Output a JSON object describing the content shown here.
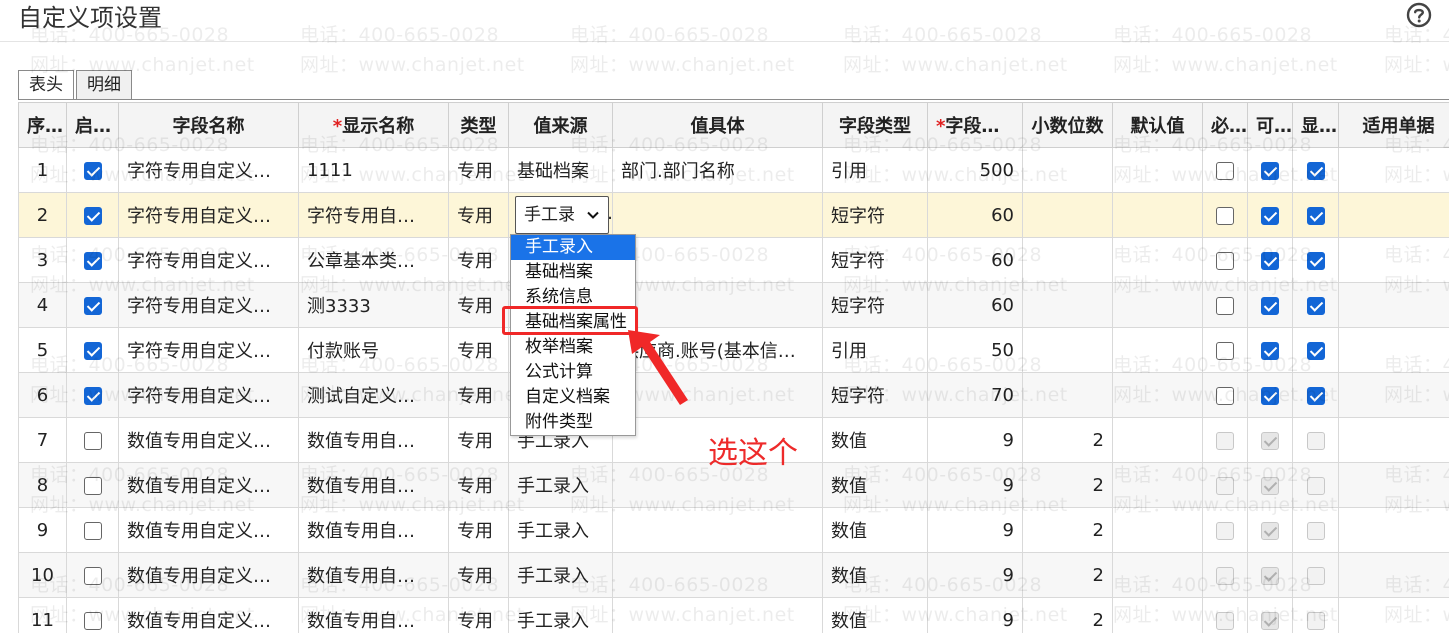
{
  "page": {
    "title": "自定义项设置"
  },
  "tabs": [
    {
      "label": "表头",
      "active": true
    },
    {
      "label": "明细",
      "active": false
    }
  ],
  "watermark": {
    "phone": "电话：400-665-0028",
    "site": "网址：www.chanjet.net"
  },
  "table": {
    "columns": [
      {
        "key": "idx",
        "label": "序号",
        "required": false
      },
      {
        "key": "enabled",
        "label": "启用",
        "required": false
      },
      {
        "key": "field_name",
        "label": "字段名称",
        "required": false
      },
      {
        "key": "display_name",
        "label": "显示名称",
        "required": true
      },
      {
        "key": "type",
        "label": "类型",
        "required": false
      },
      {
        "key": "value_source",
        "label": "值来源",
        "required": false
      },
      {
        "key": "value_detail",
        "label": "值具体",
        "required": false
      },
      {
        "key": "field_type",
        "label": "字段类型",
        "required": false
      },
      {
        "key": "length",
        "label": "字段长度",
        "required": true
      },
      {
        "key": "decimals",
        "label": "小数位数",
        "required": false
      },
      {
        "key": "default",
        "label": "默认值",
        "required": false
      },
      {
        "key": "mandatory",
        "label": "必录",
        "required": false
      },
      {
        "key": "editable",
        "label": "可改",
        "required": false
      },
      {
        "key": "visible",
        "label": "显示",
        "required": false
      },
      {
        "key": "doc",
        "label": "适用单据",
        "required": false
      }
    ],
    "rows": [
      {
        "idx": "1",
        "enabled": true,
        "field_name": "字符专用自定义…",
        "display_name": "1111",
        "type": "专用",
        "value_source": "基础档案",
        "value_detail": "部门.部门名称",
        "field_type": "引用",
        "length": "500",
        "decimals": "",
        "default": "",
        "mandatory": "off",
        "editable": "on",
        "visible": "on",
        "doc": ""
      },
      {
        "idx": "2",
        "enabled": true,
        "field_name": "字符专用自定义…",
        "display_name": "字符专用自…",
        "type": "专用",
        "value_source": "手工录",
        "value_detail": "",
        "field_type": "短字符",
        "length": "60",
        "decimals": "",
        "default": "",
        "mandatory": "off",
        "editable": "on",
        "visible": "on",
        "doc": "",
        "selected": true
      },
      {
        "idx": "3",
        "enabled": true,
        "field_name": "字符专用自定义…",
        "display_name": "公章基本类…",
        "type": "专用",
        "value_source": "",
        "value_detail": "",
        "field_type": "短字符",
        "length": "60",
        "decimals": "",
        "default": "",
        "mandatory": "off",
        "editable": "on",
        "visible": "on",
        "doc": ""
      },
      {
        "idx": "4",
        "enabled": true,
        "field_name": "字符专用自定义…",
        "display_name": "测3333",
        "type": "专用",
        "value_source": "",
        "value_detail": "",
        "field_type": "短字符",
        "length": "60",
        "decimals": "",
        "default": "",
        "mandatory": "off",
        "editable": "on",
        "visible": "on",
        "doc": ""
      },
      {
        "idx": "5",
        "enabled": true,
        "field_name": "字符专用自定义…",
        "display_name": "付款账号",
        "type": "专用",
        "value_source": "",
        "value_detail": "供应商.账号(基本信…",
        "field_type": "引用",
        "length": "50",
        "decimals": "",
        "default": "",
        "mandatory": "off",
        "editable": "on",
        "visible": "on",
        "doc": ""
      },
      {
        "idx": "6",
        "enabled": true,
        "field_name": "字符专用自定义…",
        "display_name": "测试自定义…",
        "type": "专用",
        "value_source": "",
        "value_detail": "",
        "field_type": "短字符",
        "length": "70",
        "decimals": "",
        "default": "",
        "mandatory": "off",
        "editable": "on",
        "visible": "on",
        "doc": ""
      },
      {
        "idx": "7",
        "enabled": false,
        "field_name": "数值专用自定义…",
        "display_name": "数值专用自…",
        "type": "专用",
        "value_source": "手工录入",
        "value_detail": "",
        "field_type": "数值",
        "length": "9",
        "decimals": "2",
        "default": "",
        "mandatory": "dis",
        "editable": "dis-on",
        "visible": "dis",
        "doc": ""
      },
      {
        "idx": "8",
        "enabled": false,
        "field_name": "数值专用自定义…",
        "display_name": "数值专用自…",
        "type": "专用",
        "value_source": "手工录入",
        "value_detail": "",
        "field_type": "数值",
        "length": "9",
        "decimals": "2",
        "default": "",
        "mandatory": "dis",
        "editable": "dis-on",
        "visible": "dis",
        "doc": ""
      },
      {
        "idx": "9",
        "enabled": false,
        "field_name": "数值专用自定义…",
        "display_name": "数值专用自…",
        "type": "专用",
        "value_source": "手工录入",
        "value_detail": "",
        "field_type": "数值",
        "length": "9",
        "decimals": "2",
        "default": "",
        "mandatory": "dis",
        "editable": "dis-on",
        "visible": "dis",
        "doc": ""
      },
      {
        "idx": "10",
        "enabled": false,
        "field_name": "数值专用自定义…",
        "display_name": "数值专用自…",
        "type": "专用",
        "value_source": "手工录入",
        "value_detail": "",
        "field_type": "数值",
        "length": "9",
        "decimals": "2",
        "default": "",
        "mandatory": "dis",
        "editable": "dis-on",
        "visible": "dis",
        "doc": ""
      },
      {
        "idx": "11",
        "enabled": false,
        "field_name": "数值专用自定义…",
        "display_name": "数值专用自…",
        "type": "专用",
        "value_source": "手工录入",
        "value_detail": "",
        "field_type": "数值",
        "length": "9",
        "decimals": "2",
        "default": "",
        "mandatory": "dis",
        "editable": "dis-on",
        "visible": "dis",
        "doc": ""
      }
    ]
  },
  "dropdown": {
    "options": [
      "手工录入",
      "基础档案",
      "系统信息",
      "基础档案属性",
      "枚举档案",
      "公式计算",
      "自定义档案",
      "附件类型"
    ],
    "highlighted_index": 0,
    "marked_index": 3
  },
  "annotation": {
    "text": "选这个",
    "color": "#ee2a2a"
  },
  "colors": {
    "accent": "#1366d6",
    "selected_row": "#fdf6d8",
    "annotation": "#f02828"
  }
}
